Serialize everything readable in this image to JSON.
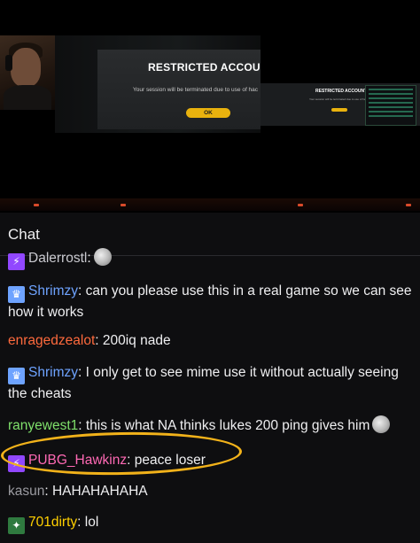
{
  "stream": {
    "main_modal": {
      "title": "RESTRICTED ACCOUI",
      "message": "Your session will be terminated due to use of hac",
      "ok_label": "OK"
    },
    "small_modal": {
      "title": "RESTRICTED ACCOUNT",
      "message": "Your session will be terminated due to use of hacking",
      "ok_label": ""
    },
    "colors": {
      "ok_button": "#e9b20e",
      "modal_bg": "#24272a"
    }
  },
  "chat": {
    "title": "Chat",
    "messages": [
      {
        "badge": "prime",
        "user": "Dalerrostl",
        "user_color": "#c9c9cf",
        "text": ":",
        "emote": "face-emote",
        "partial": true
      },
      {
        "badge": "crown",
        "user": "Shrimzy",
        "user_color": "#6ea3ff",
        "text": ": can you please use this in a real game so we can see how it works"
      },
      {
        "badge": "",
        "user": "enragedzealot",
        "user_color": "#ff6a3d",
        "text": ": 200iq nade"
      },
      {
        "badge": "crown",
        "user": "Shrimzy",
        "user_color": "#6ea3ff",
        "text": ": I only get to see mime use it without actually seeing the cheats"
      },
      {
        "badge": "",
        "user": "ranyewest1",
        "user_color": "#7fe06b",
        "text": ": this is what NA thinks lukes 200 ping gives him",
        "emote": "face-emote"
      },
      {
        "badge": "prime",
        "user": "PUBG_Hawkinz",
        "user_color": "#ff69b4",
        "text": ": peace loser"
      },
      {
        "badge": "",
        "user": "kasun",
        "user_color": "#9b9ba1",
        "text": ": HAHAHAHAHA"
      },
      {
        "badge": "gift",
        "user": "701dirty",
        "user_color": "#ffd000",
        "text": ": lol"
      }
    ],
    "badge_icons": {
      "crown": "crown-icon",
      "prime": "prime-badge-icon",
      "gift": "gift-badge-icon"
    },
    "highlight_color": "#f2b21a"
  }
}
